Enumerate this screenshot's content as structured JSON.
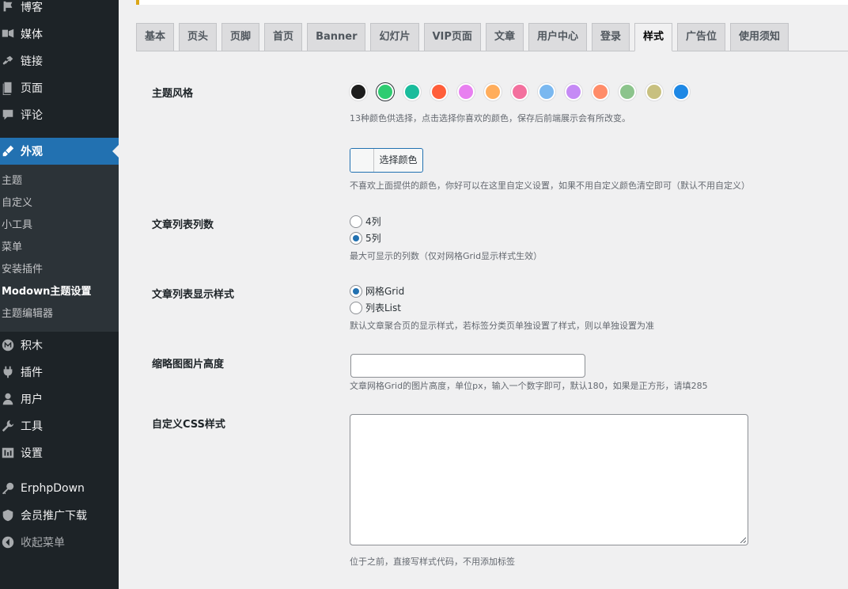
{
  "sidebar": {
    "items": [
      {
        "label": "博客",
        "icon": "pushpin-icon"
      },
      {
        "label": "媒体",
        "icon": "media-icon"
      },
      {
        "label": "链接",
        "icon": "link-icon"
      },
      {
        "label": "页面",
        "icon": "page-icon"
      },
      {
        "label": "评论",
        "icon": "comment-icon"
      },
      {
        "label": "外观",
        "icon": "paintbrush-icon"
      },
      {
        "label": "积木",
        "icon": "blocks-icon"
      },
      {
        "label": "插件",
        "icon": "plugin-icon"
      },
      {
        "label": "用户",
        "icon": "user-icon"
      },
      {
        "label": "工具",
        "icon": "wrench-icon"
      },
      {
        "label": "设置",
        "icon": "settings-icon"
      },
      {
        "label": "ErphpDown",
        "icon": "key-icon"
      },
      {
        "label": "会员推广下载",
        "icon": "shield-icon"
      },
      {
        "label": "收起菜单",
        "icon": "collapse-icon"
      }
    ],
    "submenu": [
      "主题",
      "自定义",
      "小工具",
      "菜单",
      "安装插件",
      "Modown主题设置",
      "主题编辑器"
    ]
  },
  "tabs": [
    "基本",
    "页头",
    "页脚",
    "首页",
    "Banner",
    "幻灯片",
    "VIP页面",
    "文章",
    "用户中心",
    "登录",
    "样式",
    "广告位",
    "使用须知"
  ],
  "form": {
    "theme_style": {
      "label": "主题风格",
      "colors": [
        "#1d1d1d",
        "#2ecc71",
        "#1abc9c",
        "#ff5e3a",
        "#e880f0",
        "#ffad5c",
        "#f3709e",
        "#7ab8f0",
        "#c58af5",
        "#ff8c69",
        "#8cc48c",
        "#c8c080",
        "#1e88e5"
      ],
      "selected_index": 1,
      "desc": "13种颜色供选择，点击选择你喜欢的颜色，保存后前端展示会有所改变。"
    },
    "custom_color": {
      "button_label": "选择颜色",
      "desc": "不喜欢上面提供的颜色，你好可以在这里自定义设置，如果不用自定义颜色清空即可（默认不用自定义）"
    },
    "columns": {
      "label": "文章列表列数",
      "options": [
        "4列",
        "5列"
      ],
      "selected": "5列",
      "desc": "最大可显示的列数（仅对网格Grid显示样式生效）"
    },
    "list_style": {
      "label": "文章列表显示样式",
      "options": [
        "网格Grid",
        "列表List"
      ],
      "selected": "网格Grid",
      "desc": "默认文章聚合页的显示样式，若标签分类页单独设置了样式，则以单独设置为准"
    },
    "thumb_height": {
      "label": "缩略图图片高度",
      "value": "",
      "desc": "文章网格Grid的图片高度，单位px，输入一个数字即可，默认180，如果是正方形，请填285"
    },
    "custom_css": {
      "label": "自定义CSS样式",
      "value": "",
      "desc": "位于之前，直接写样式代码，不用添加标签"
    }
  },
  "colors": {
    "accent": "#2271b1",
    "sidebar_bg": "#1d2327",
    "submenu_bg": "#2c3338"
  }
}
